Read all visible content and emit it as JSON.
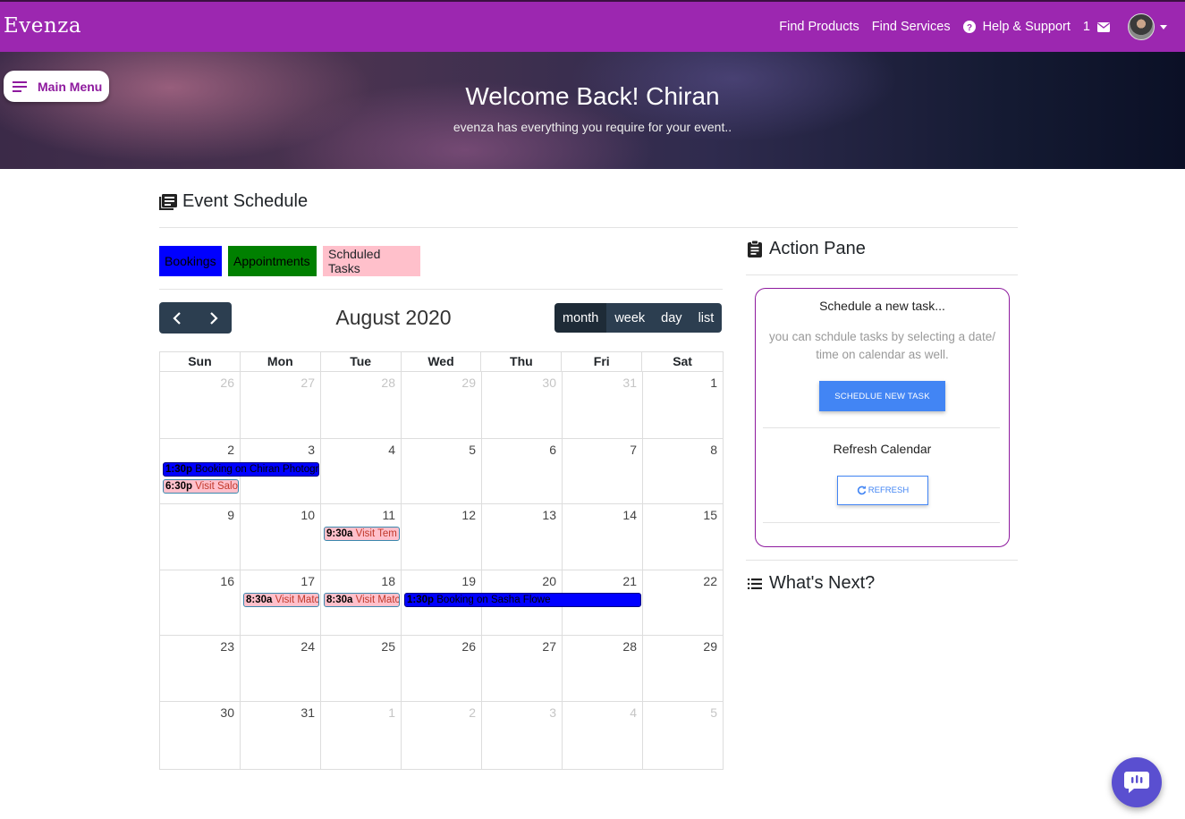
{
  "navbar": {
    "brand": "Evenza",
    "links": [
      "Find Products",
      "Find Services",
      "Help & Support"
    ],
    "message_count": "1",
    "accent": "#9c27b0"
  },
  "hero": {
    "title": "Welcome Back! Chiran",
    "subtitle": "evenza has everything you require for your event..",
    "menu_label": "Main Menu"
  },
  "schedule": {
    "title": "Event Schedule",
    "legend": [
      "Bookings",
      "Appointments",
      "Schduled Tasks"
    ]
  },
  "calendar": {
    "title": "August 2020",
    "views": [
      "month",
      "week",
      "day",
      "list"
    ],
    "active_view": "month",
    "weekdays": [
      "Sun",
      "Mon",
      "Tue",
      "Wed",
      "Thu",
      "Fri",
      "Sat"
    ],
    "weeks": [
      [
        "26",
        "27",
        "28",
        "29",
        "30",
        "31",
        "1"
      ],
      [
        "2",
        "3",
        "4",
        "5",
        "6",
        "7",
        "8"
      ],
      [
        "9",
        "10",
        "11",
        "12",
        "13",
        "14",
        "15"
      ],
      [
        "16",
        "17",
        "18",
        "19",
        "20",
        "21",
        "22"
      ],
      [
        "23",
        "24",
        "25",
        "26",
        "27",
        "28",
        "29"
      ],
      [
        "30",
        "31",
        "1",
        "2",
        "3",
        "4",
        "5"
      ]
    ],
    "events": [
      {
        "time": "1:30p",
        "title": "Booking on Chiran Photogr",
        "type": "booking"
      },
      {
        "time": "6:30p",
        "title": "Visit Salo",
        "type": "task"
      },
      {
        "time": "9:30a",
        "title": "Visit Tem",
        "type": "task"
      },
      {
        "time": "8:30a",
        "title": "Visit Matc",
        "type": "task"
      },
      {
        "time": "8:30a",
        "title": "Visit Matc",
        "type": "task"
      },
      {
        "time": "1:30p",
        "title": "Booking on Sasha Flowe",
        "type": "booking"
      }
    ]
  },
  "action_pane": {
    "title": "Action Pane",
    "new_task_heading": "Schedule a new task...",
    "new_task_help": "you can schdule tasks by selecting a date/ time on calendar as well.",
    "new_task_button": "SCHEDLUE NEW TASK",
    "refresh_heading": "Refresh Calendar",
    "refresh_button": "REFRESH"
  },
  "whats_next": {
    "title": "What's Next?"
  }
}
